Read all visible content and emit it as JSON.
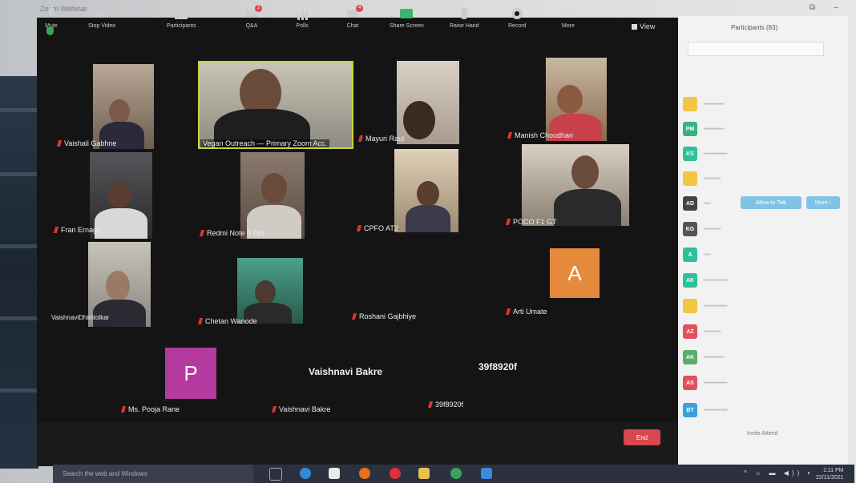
{
  "window": {
    "title": "Zoom Webinar",
    "controls": [
      "⧉",
      "–"
    ]
  },
  "meeting": {
    "view_label": "View"
  },
  "tiles": [
    {
      "key": "vaishali",
      "name": "Vaishali Gabhne"
    },
    {
      "key": "vegan",
      "name": "Vegan Outreach — Primary Zoom Acc."
    },
    {
      "key": "mayuri",
      "name": "Mayuri Raut"
    },
    {
      "key": "manish",
      "name": "Manish Choudhari"
    },
    {
      "key": "fran",
      "name": "Fran Ernage"
    },
    {
      "key": "redmi",
      "name": "Redmi Note 9 Pro"
    },
    {
      "key": "cpfo",
      "name": "CPFO AT2"
    },
    {
      "key": "poco",
      "name": "POCO F1 GT"
    },
    {
      "key": "vaishnavi_d",
      "name": "VaishnaviDhimtolkar"
    },
    {
      "key": "chetan",
      "name": "Chetan Wanode"
    },
    {
      "key": "roshani",
      "name": "Roshani Gajbhiye"
    },
    {
      "key": "arti",
      "name": "Arti Umate",
      "initial": "A"
    },
    {
      "key": "pooja",
      "name": "Ms. Pooja Rane",
      "initial": "P"
    },
    {
      "key": "vaishnavi_b",
      "name": "Vaishnavi Bakre",
      "bigname": "Vaishnavi Bakre"
    },
    {
      "key": "code",
      "name": "39f8920f",
      "bigname": "39f8920f"
    }
  ],
  "toolbar": {
    "items": [
      {
        "label": "Mute",
        "icon": "microphone-icon"
      },
      {
        "label": "Stop Video",
        "icon": "video-camera-icon"
      },
      {
        "label": "Participants",
        "icon": "participants-icon",
        "count": "83"
      },
      {
        "label": "Q&A",
        "icon": "qa-icon",
        "badge": "2"
      },
      {
        "label": "Polls",
        "icon": "polls-icon"
      },
      {
        "label": "Chat",
        "icon": "chat-icon",
        "badge": "4"
      },
      {
        "label": "Share Screen",
        "icon": "share-screen-icon"
      },
      {
        "label": "Raise Hand",
        "icon": "raise-hand-icon"
      },
      {
        "label": "Record",
        "icon": "record-icon"
      },
      {
        "label": "More",
        "icon": "more-icon"
      }
    ],
    "end_label": "End"
  },
  "panel": {
    "title": "Participants (83)",
    "participants": [
      {
        "initials": "",
        "color": "#f4c542"
      },
      {
        "initials": "PM",
        "color": "#36b37e"
      },
      {
        "initials": "KS",
        "color": "#2fbf9a"
      },
      {
        "initials": "",
        "color": "#f4c542"
      },
      {
        "initials": "AD",
        "color": "#444444",
        "allow_label": "Allow to Talk",
        "mute_label": "More ›"
      },
      {
        "initials": "KG",
        "color": "#555555"
      },
      {
        "initials": "A",
        "color": "#2fbf9a"
      },
      {
        "initials": "AK",
        "color": "#2fbf9a"
      },
      {
        "initials": "",
        "color": "#f4c542"
      },
      {
        "initials": "AZ",
        "color": "#e0505e"
      },
      {
        "initials": "AK",
        "color": "#5aae6a"
      },
      {
        "initials": "AS",
        "color": "#e0505e"
      },
      {
        "initials": "BT",
        "color": "#3aa0d8"
      }
    ],
    "invite_label": "Invite  Attend"
  },
  "taskbar": {
    "search_placeholder": "Search the web and Windows",
    "time": "1:11 PM",
    "date": "22/11/2021"
  }
}
